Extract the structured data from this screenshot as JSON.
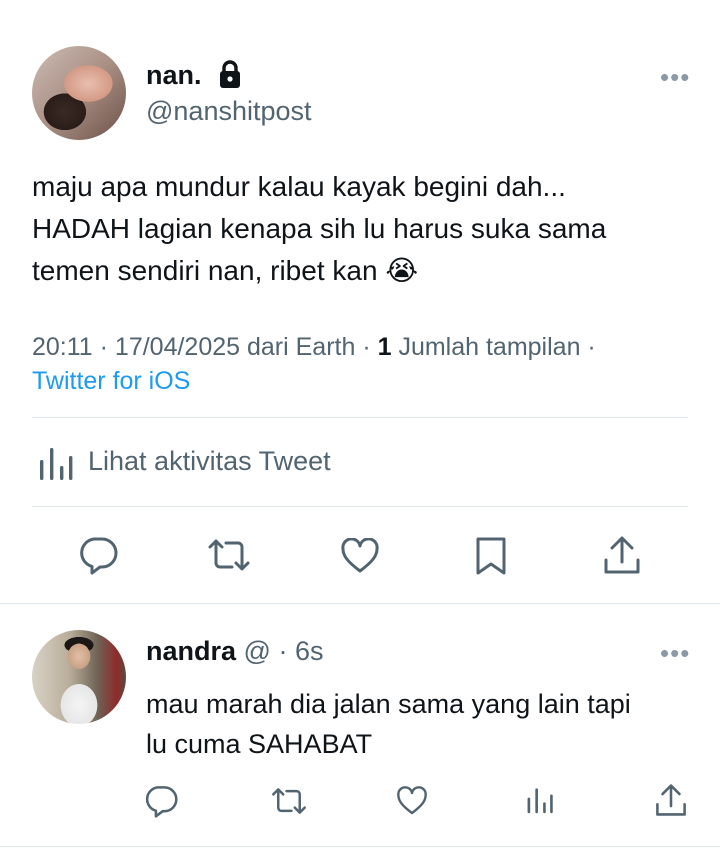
{
  "tweet": {
    "author_name": "nan.",
    "author_handle": "@nanshitpost",
    "more": "•••",
    "text_lines": [
      "maju apa mundur kalau kayak begini dah...",
      "HADAH lagian kenapa sih lu harus suka sama",
      "temen sendiri nan, ribet kan"
    ],
    "emoji": "😭",
    "meta_time": "20:11 · 17/04/2025 dari Earth · ",
    "meta_views_count": "1",
    "meta_views_label": " Jumlah tampilan ·",
    "source": "Twitter for iOS",
    "activity_label": "Lihat aktivitas Tweet"
  },
  "reply": {
    "author_name": "nandra",
    "author_handle": "@",
    "time": " · 6s",
    "more": "•••",
    "text_lines": [
      "mau marah dia jalan sama yang lain tapi",
      "lu cuma SAHABAT"
    ]
  },
  "icons": [
    "lock-icon",
    "reply-icon",
    "retweet-icon",
    "like-icon",
    "bookmark-icon",
    "share-icon",
    "analytics-icon"
  ],
  "colors": {
    "text": "#0f1419",
    "secondary": "#536471",
    "link": "#1d9bf0",
    "divider": "#e1e8ed"
  }
}
